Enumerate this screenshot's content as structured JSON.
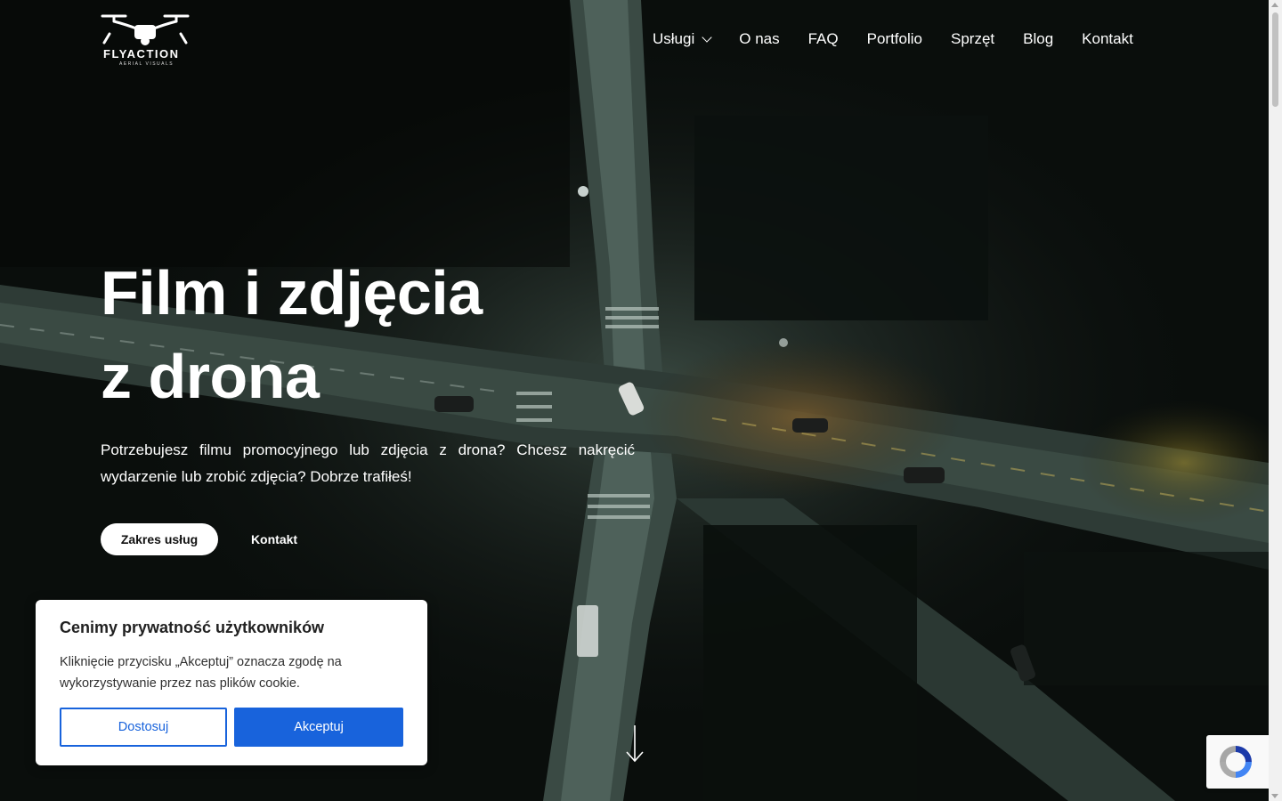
{
  "brand": {
    "name": "FLYACTION",
    "tagline": "AERIAL VISUALS"
  },
  "nav": {
    "items": [
      {
        "label": "Usługi",
        "has_dropdown": true
      },
      {
        "label": "O nas"
      },
      {
        "label": "FAQ"
      },
      {
        "label": "Portfolio"
      },
      {
        "label": "Sprzęt"
      },
      {
        "label": "Blog"
      },
      {
        "label": "Kontakt"
      }
    ]
  },
  "hero": {
    "title_line1": "Film i zdjęcia",
    "title_line2": "z drona",
    "text": "Potrzebujesz filmu promocyjnego lub zdjęcia z drona? Chcesz nakręcić wydarzenie lub zrobić zdjęcia? Dobrze trafiłeś!",
    "primary_button": "Zakres usług",
    "secondary_button": "Kontakt"
  },
  "cookie": {
    "title": "Cenimy prywatność użytkowników",
    "text": "Kliknięcie przycisku „Akceptuj” oznacza zgodę na wykorzystywanie przez nas plików cookie.",
    "customize_button": "Dostosuj",
    "accept_button": "Akceptuj"
  },
  "colors": {
    "accent": "#1863dc",
    "background": "#0b0f0d",
    "text": "#ffffff"
  }
}
